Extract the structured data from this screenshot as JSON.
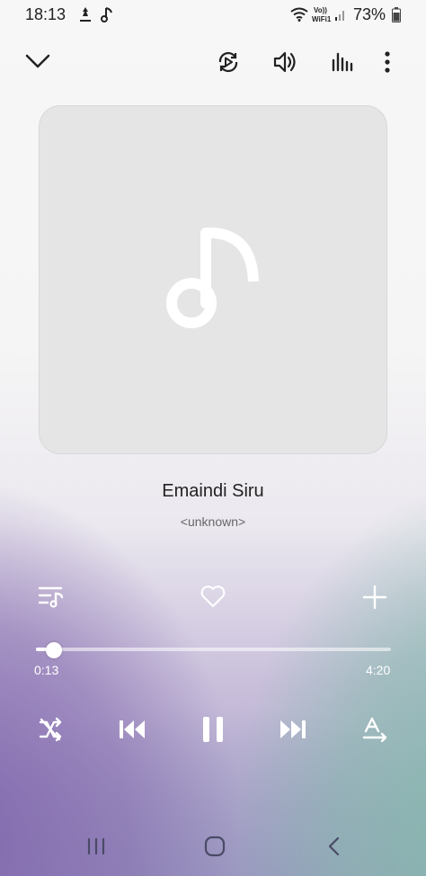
{
  "status_bar": {
    "time": "18:13",
    "battery_percent": "73%",
    "icons": [
      "notification-icon",
      "music-note-icon",
      "wifi-icon",
      "signal-icon",
      "battery-icon"
    ]
  },
  "toolbar": {
    "icons": [
      "collapse-chevron-icon",
      "smart-view-icon",
      "volume-icon",
      "equalizer-icon",
      "more-options-icon"
    ]
  },
  "song": {
    "title": "Emaindi Siru",
    "artist": "<unknown>"
  },
  "actions": {
    "icons": [
      "playlist-icon",
      "favorite-heart-icon",
      "add-icon"
    ]
  },
  "playback": {
    "current_time": "0:13",
    "total_time": "4:20",
    "progress_fraction": 0.05
  },
  "controls": {
    "icons": [
      "shuffle-off-icon",
      "previous-icon",
      "pause-icon",
      "next-icon",
      "repeat-icon"
    ]
  },
  "nav_bar": {
    "icons": [
      "recent-apps-icon",
      "home-icon",
      "back-icon"
    ]
  },
  "colors": {
    "accent": "#ffffff",
    "art_background": "#e5e5e5",
    "purple": "#8066ac",
    "teal": "#82b9aa"
  }
}
